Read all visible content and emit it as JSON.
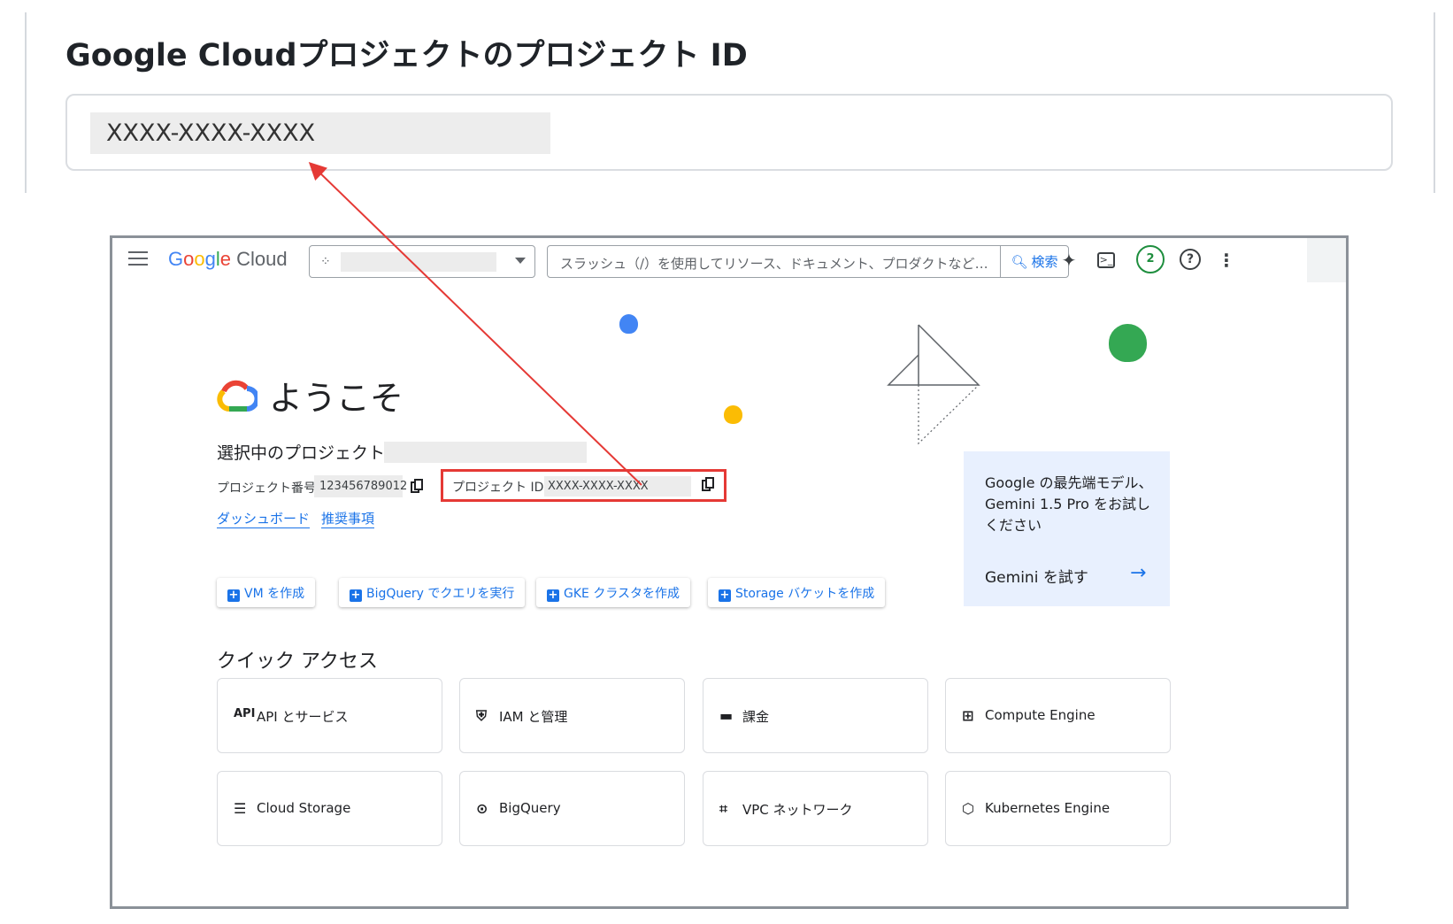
{
  "doc": {
    "title": "Google Cloudプロジェクトのプロジェクト ID",
    "input_value": "XXXX-XXXX-XXXX"
  },
  "console": {
    "logo": {
      "g1": "G",
      "g2": "o",
      "g3": "o",
      "g4": "g",
      "g5": "l",
      "g6": "e",
      "product": "Cloud"
    },
    "search_placeholder": "スラッシュ（/）を使用してリソース、ドキュメント、プロダクトなどを検索",
    "search_button": "検索",
    "notification_count": "2",
    "help_label": "?",
    "welcome_title": "ようこそ",
    "selected_project_label": "選択中のプロジェクト",
    "project_number_label": "プロジェクト番号:",
    "project_number_value": "123456789012",
    "project_id_label": "プロジェクト ID:",
    "project_id_value": "XXXX-XXXX-XXXX",
    "links": [
      "ダッシュボード",
      "推奨事項"
    ],
    "actions": [
      "VM を作成",
      "BigQuery でクエリを実行",
      "GKE クラスタを作成",
      "Storage バケットを作成"
    ],
    "gemini": {
      "text": "Google の最先端モデル、Gemini 1.5 Pro をお試しください",
      "link": "Gemini を試す",
      "arrow": "→"
    },
    "quick_access_title": "クイック アクセス",
    "quick_access": [
      {
        "icon": "api-icon",
        "glyph": "API",
        "label": "API とサービス"
      },
      {
        "icon": "shield-icon",
        "glyph": "⛨",
        "label": "IAM と管理"
      },
      {
        "icon": "billing-icon",
        "glyph": "▬",
        "label": "課金"
      },
      {
        "icon": "chip-icon",
        "glyph": "⊞",
        "label": "Compute Engine"
      },
      {
        "icon": "storage-icon",
        "glyph": "☰",
        "label": "Cloud Storage"
      },
      {
        "icon": "bigquery-icon",
        "glyph": "⊙",
        "label": "BigQuery"
      },
      {
        "icon": "network-icon",
        "glyph": "⌗",
        "label": "VPC ネットワーク"
      },
      {
        "icon": "kubernetes-icon",
        "glyph": "⬡",
        "label": "Kubernetes Engine"
      }
    ]
  },
  "colors": {
    "accent": "#1a73e8",
    "highlight": "#e53935",
    "badge": "#1e8e3e",
    "gemini_bg": "#e8f0fe"
  }
}
